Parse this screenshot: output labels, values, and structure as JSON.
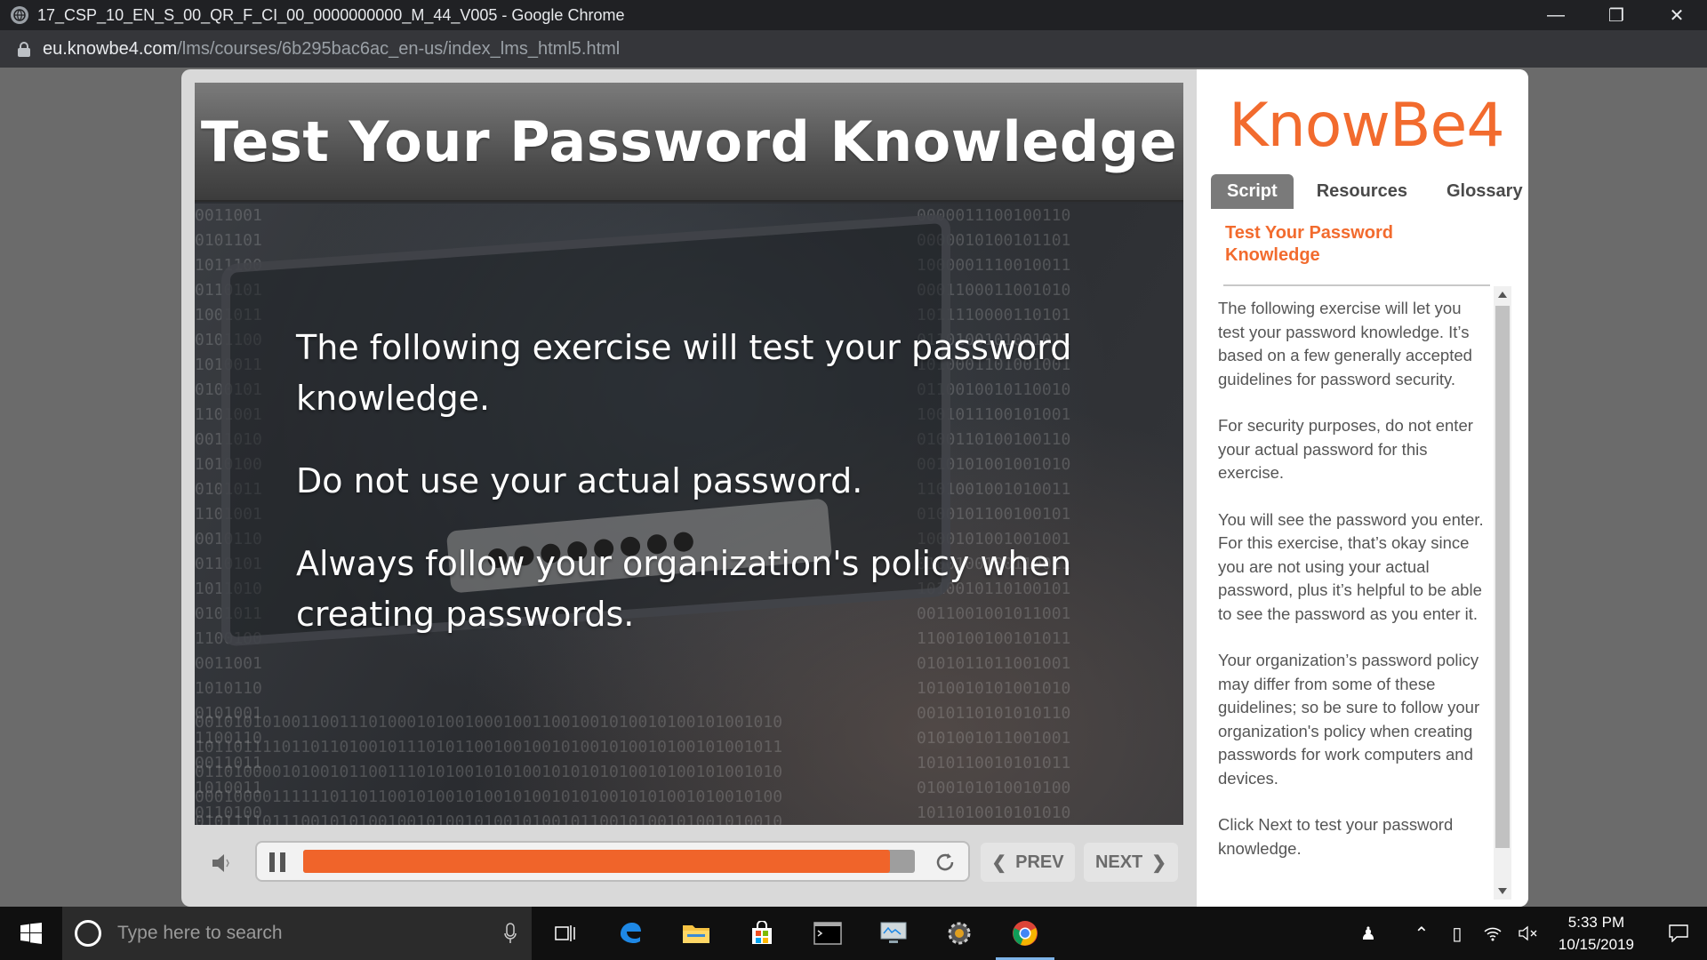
{
  "browser": {
    "window_title": "17_CSP_10_EN_S_00_QR_F_CI_00_0000000000_M_44_V005 - Google Chrome",
    "url_host": "eu.knowbe4.com",
    "url_path": "/lms/courses/6b295bac6ac_en-us/index_lms_html5.html"
  },
  "slide": {
    "title": "Test Your Password Knowledge",
    "paragraphs": [
      "The following exercise will test your password knowledge.",
      "Do not use your actual password.",
      "Always follow your organization's policy when creating passwords."
    ]
  },
  "player": {
    "progress": 0.96,
    "prev_label": "PREV",
    "next_label": "NEXT"
  },
  "sidebar": {
    "logo": "KnowBe4",
    "tabs": [
      "Script",
      "Resources",
      "Glossary"
    ],
    "active_tab": "Script",
    "heading": "Test Your Password Knowledge",
    "script": [
      "The following exercise will let you test your password knowledge. It’s based on a few generally accepted guidelines for password security.",
      "For security purposes, do not enter your actual password for this exercise.",
      "You will see the password you enter. For this exercise, that’s okay since you are not using your actual password, plus it’s helpful to be able to see the password as you enter it.",
      "Your organization’s password policy may differ from some of these guidelines; so be sure to follow your organization's policy when creating passwords for work computers and devices.",
      "Click Next to test your password knowledge."
    ]
  },
  "taskbar": {
    "search_placeholder": "Type here to search",
    "time": "5:33 PM",
    "date": "10/15/2019"
  },
  "colors": {
    "brand_orange": "#f26b2e",
    "progress_orange": "#f0642a"
  }
}
